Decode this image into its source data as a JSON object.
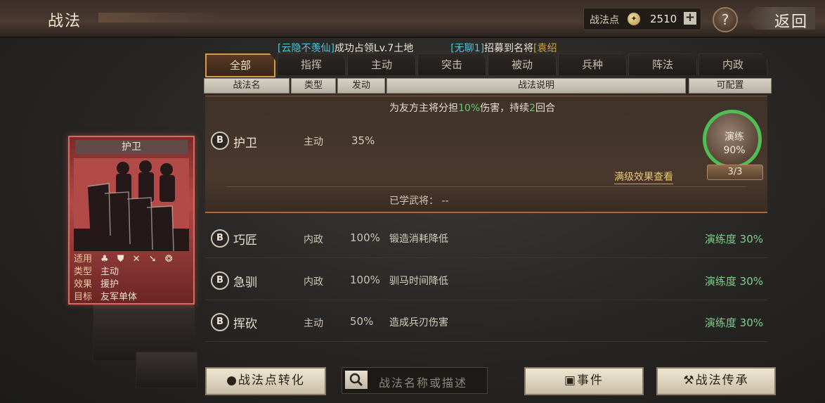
{
  "header": {
    "title": "战法",
    "points_label": "战法点",
    "points_value": "2510",
    "plus_label": "+",
    "help_label": "?",
    "back_label": "返回"
  },
  "ticker": {
    "msg1_user": "[云隐不羡仙]",
    "msg1_text": "成功占领Lv.7土地",
    "msg2_user": "[无聊1]",
    "msg2_text": "招募到名将",
    "msg2_tail": "[袁绍"
  },
  "tabs": [
    "全部",
    "指挥",
    "主动",
    "突击",
    "被动",
    "兵种",
    "阵法",
    "内政"
  ],
  "columns": {
    "name": "战法名",
    "type": "类型",
    "trigger": "发动",
    "desc": "战法说明",
    "config": "可配置"
  },
  "selected": {
    "grade": "B",
    "name": "护卫",
    "type": "主动",
    "rate": "35%",
    "desc_prefix": "为友方主将分担",
    "desc_pct": "10%",
    "desc_mid": "伤害，持续",
    "desc_turns": "2",
    "desc_suffix": "回合",
    "max_level_link": "满级效果查看",
    "learned_label": "已学武将：",
    "learned_value": "--",
    "drill_label": "演练",
    "drill_pct": "90%",
    "drill_count": "3/3"
  },
  "rows": [
    {
      "grade": "B",
      "name": "巧匠",
      "type": "内政",
      "rate": "100%",
      "desc": "锻造消耗降低",
      "drill": "演练度 30%"
    },
    {
      "grade": "B",
      "name": "急驯",
      "type": "内政",
      "rate": "100%",
      "desc": "驯马时间降低",
      "drill": "演练度 30%"
    },
    {
      "grade": "B",
      "name": "挥砍",
      "type": "主动",
      "rate": "50%",
      "desc": "造成兵刃伤害",
      "drill": "演练度 30%"
    }
  ],
  "card": {
    "title": "护卫",
    "suit_label": "适用",
    "suit_icons": "♣ ⛊ ✕ ➘ ❂",
    "type_label": "类型",
    "type_value": "主动",
    "effect_label": "效果",
    "effect_value": "援护",
    "target_label": "目标",
    "target_value": "友军单体"
  },
  "bottom": {
    "convert_label": "战法点转化",
    "search_placeholder": "战法名称或描述",
    "events_label": "事件",
    "inherit_label": "战法传承"
  },
  "colors": {
    "accent_gold": "#d99a45",
    "cyan": "#4fc3d8",
    "green": "#4fbf55",
    "card_border": "#e06a5a"
  }
}
